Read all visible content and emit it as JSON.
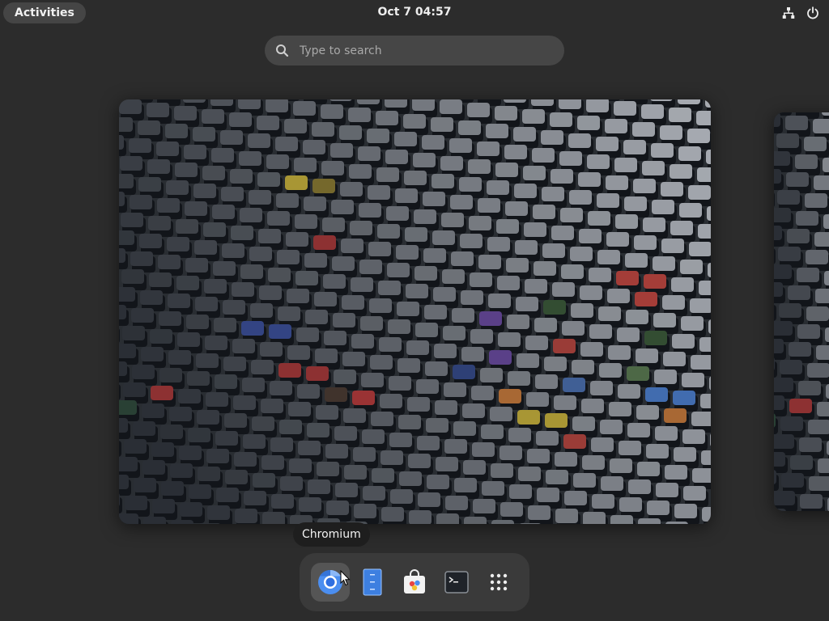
{
  "topbar": {
    "activities_label": "Activities",
    "clock": "Oct 7  04:57",
    "tray": [
      {
        "icon": "network-icon"
      },
      {
        "icon": "power-icon"
      }
    ]
  },
  "search": {
    "placeholder": "Type to search",
    "icon": "search-icon"
  },
  "workspaces": [
    {
      "name": "current-workspace",
      "wallpaper": "mechanical-keyboard-keycaps"
    },
    {
      "name": "next-workspace",
      "wallpaper": "mechanical-keyboard-keycaps"
    }
  ],
  "tooltip": {
    "label": "Chromium"
  },
  "dash": {
    "items": [
      {
        "name": "Chromium",
        "icon": "chromium-icon",
        "active": true
      },
      {
        "name": "Text Editor",
        "icon": "text-editor-icon",
        "active": false
      },
      {
        "name": "Software",
        "icon": "software-icon",
        "active": false
      },
      {
        "name": "Terminal",
        "icon": "terminal-icon",
        "active": false
      },
      {
        "name": "Show Apps",
        "icon": "app-grid-icon",
        "active": false
      }
    ]
  },
  "colors": {
    "background": "#2c2c2c",
    "panel_pill": "#454545",
    "search_bg": "#464646",
    "dash_bg": "#3a3a3a",
    "tooltip_bg": "#1e1e1e",
    "chromium_blue": "#4b8ef0"
  }
}
